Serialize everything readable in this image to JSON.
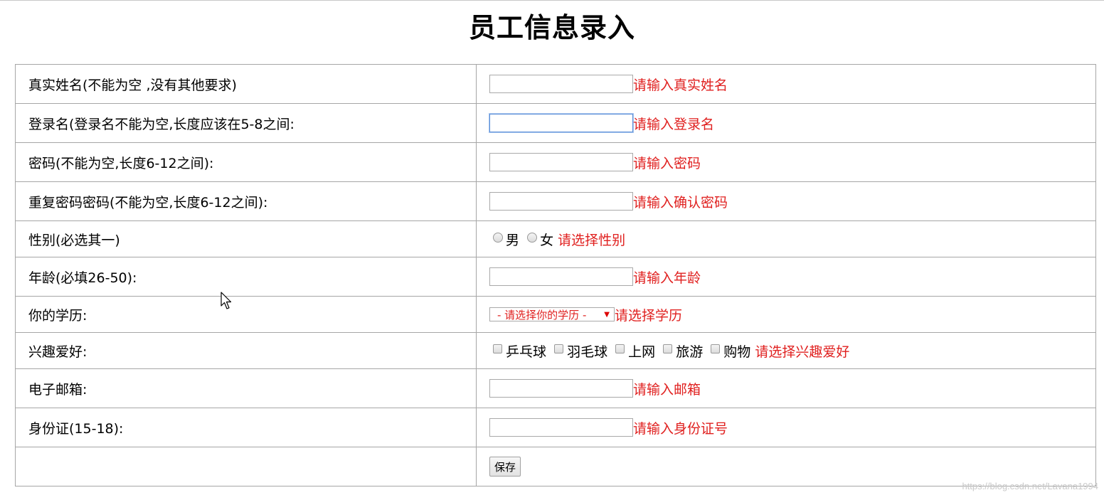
{
  "title": "员工信息录入",
  "rows": {
    "realname": {
      "label": "真实姓名(不能为空 ,没有其他要求)",
      "value": "",
      "hint": "请输入真实姓名"
    },
    "loginname": {
      "label": "登录名(登录名不能为空,长度应该在5-8之间:",
      "value": "",
      "hint": "请输入登录名"
    },
    "password": {
      "label": "密码(不能为空,长度6-12之间):",
      "value": "",
      "hint": "请输入密码"
    },
    "repassword": {
      "label": "重复密码密码(不能为空,长度6-12之间):",
      "value": "",
      "hint": "请输入确认密码"
    },
    "gender": {
      "label": "性别(必选其一)",
      "options": [
        "男",
        "女"
      ],
      "hint": "请选择性别"
    },
    "age": {
      "label": "年龄(必填26-50):",
      "value": "",
      "hint": "请输入年龄"
    },
    "education": {
      "label": "你的学历:",
      "selected": "- 请选择你的学历 -",
      "hint": "请选择学历"
    },
    "hobbies": {
      "label": "兴趣爱好:",
      "options": [
        "乒乓球",
        "羽毛球",
        "上网",
        "旅游",
        "购物"
      ],
      "hint": "请选择兴趣爱好"
    },
    "email": {
      "label": "电子邮箱:",
      "value": "",
      "hint": "请输入邮箱"
    },
    "idcard": {
      "label": "身份证(15-18):",
      "value": "",
      "hint": "请输入身份证号"
    }
  },
  "save_label": "保存",
  "watermark": "https://blog.csdn.net/Lavana1994",
  "colors": {
    "hint": "#e0201f",
    "border": "#a6a6a6",
    "focus": "#5b8fd8"
  }
}
